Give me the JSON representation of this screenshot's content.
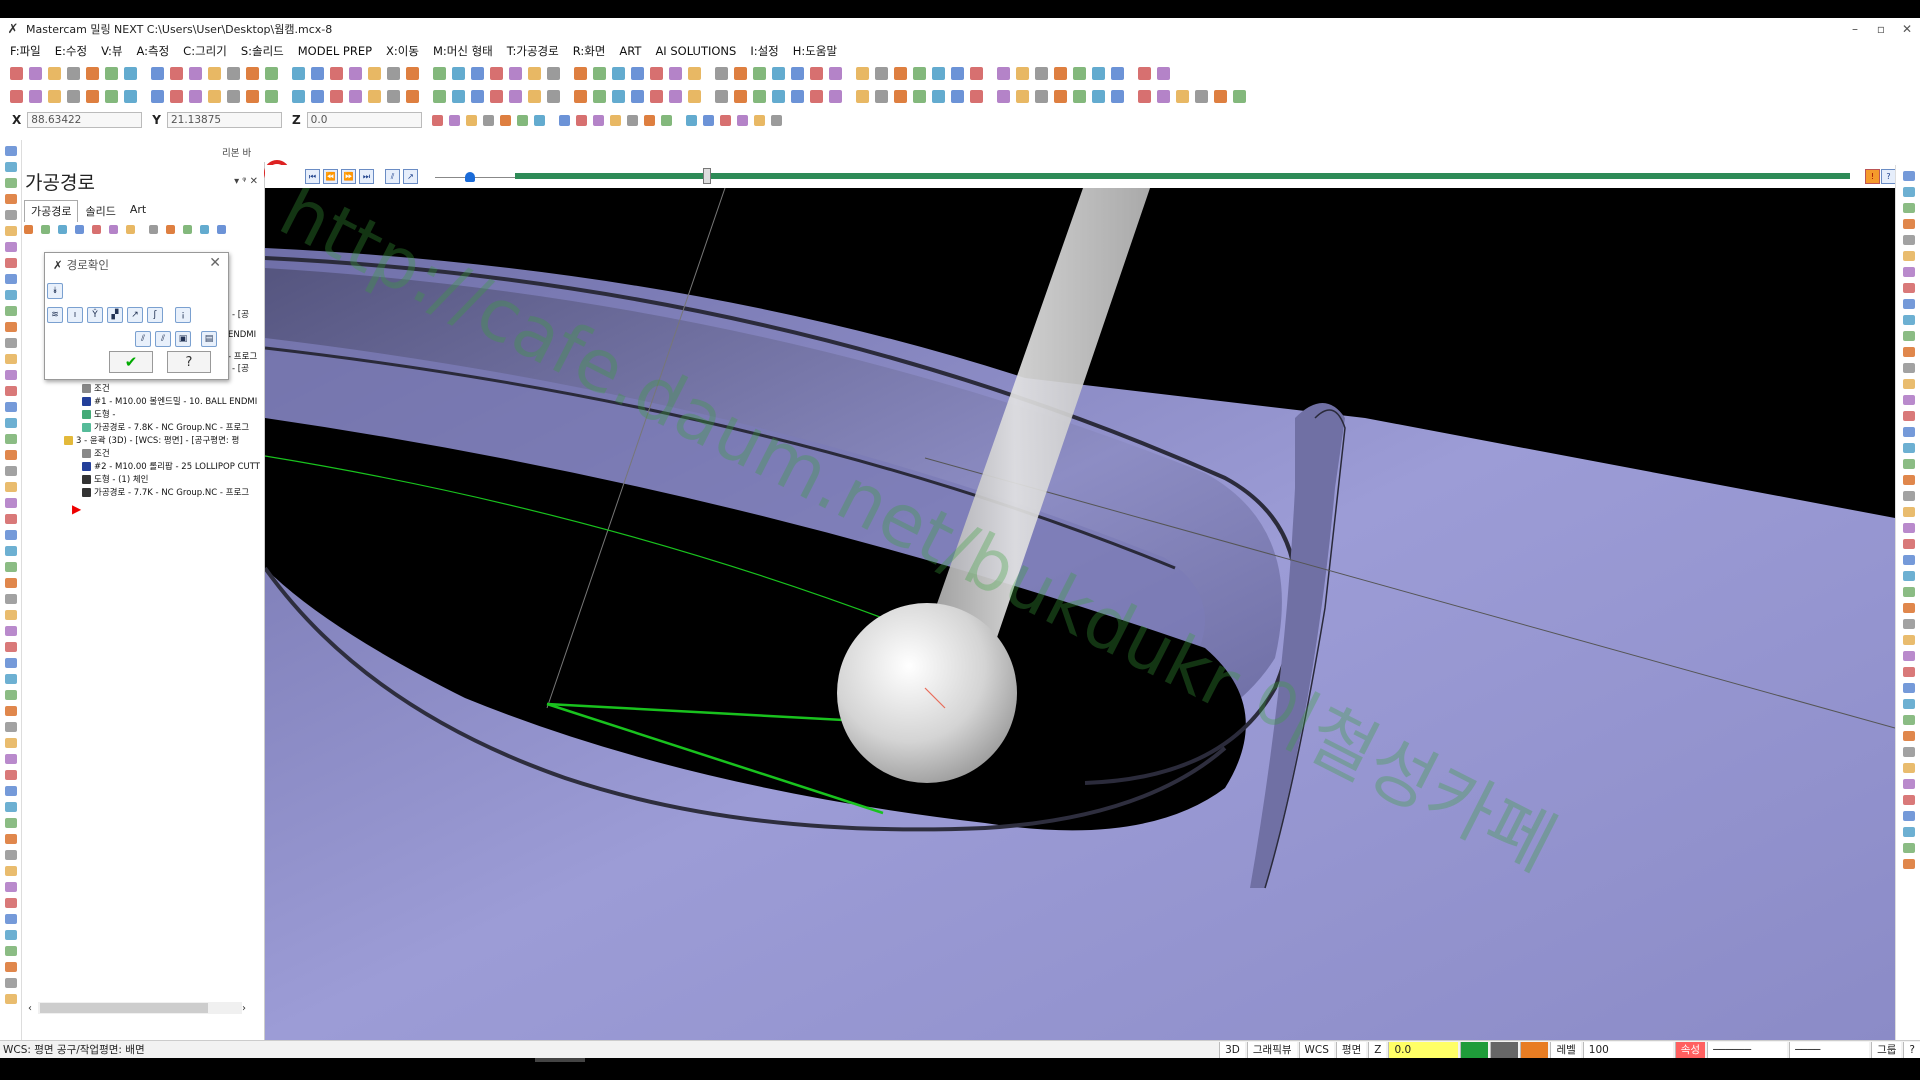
{
  "window": {
    "title": "Mastercam 밀링 NEXT  C:\\Users\\User\\Desktop\\웜캠.mcx-8",
    "min": "–",
    "restore": "▫",
    "close": "✕"
  },
  "menu": [
    "F:파일",
    "E:수정",
    "V:뷰",
    "A:측정",
    "C:그리기",
    "S:솔리드",
    "MODEL PREP",
    "X:이동",
    "M:머신 형태",
    "T:가공경로",
    "R:화면",
    "ART",
    "AI SOLUTIONS",
    "I:설정",
    "H:도움말"
  ],
  "coords": {
    "x_label": "X",
    "x_value": "88.63422",
    "y_label": "Y",
    "y_value": "21.13875",
    "z_label": "Z",
    "z_value": "0.0"
  },
  "ribbon_label": "리본 바",
  "panel": {
    "title": "가공경로",
    "tools": "▾ ᵠ ✕",
    "tabs": [
      "가공경로",
      "솔리드",
      "Art"
    ]
  },
  "tree": {
    "rows": [
      "- [공",
      "ENDMI",
      "- 프로그",
      "- [공",
      "조건",
      "#1 - M10.00 볼엔드밀 - 10. BALL ENDMI",
      "도형 -",
      "가공경로 - 7.8K - NC Group.NC - 프로그",
      "3 - 윤곽 (3D) - [WCS: 평면] - [공구평면: 평",
      "조건",
      "#2 - M10.00 롤리팝 - 25 LOLLIPOP CUTT",
      "도형 - (1) 체인",
      "가공경로 - 7.7K - NC Group.NC - 프로그"
    ]
  },
  "dialog": {
    "title": "경로확인",
    "ok": "✔",
    "help": "?"
  },
  "simulation": {
    "progress_percent": 100,
    "speed_percent": 38
  },
  "watermark": "http://cafe.daum.net/bukdukr  이철성카페",
  "status": {
    "wcs_text": "WCS: 평면  공구/작업평면: 배면",
    "mode_3d": "3D",
    "graphic_view": "그래픽뷰",
    "wcs": "WCS",
    "plane": "평면",
    "z_label": "Z",
    "z_value": "0.0",
    "level_label": "레벨",
    "level_value": "100",
    "attr": "속성",
    "group": "그룹",
    "help": "?"
  },
  "colors": {
    "accent_red": "#d22222",
    "progress_green": "#2e8b57",
    "toolpath_green": "#19c21e",
    "part_surface": "#9b9bd2",
    "tool_gray": "#d6d6d6"
  }
}
